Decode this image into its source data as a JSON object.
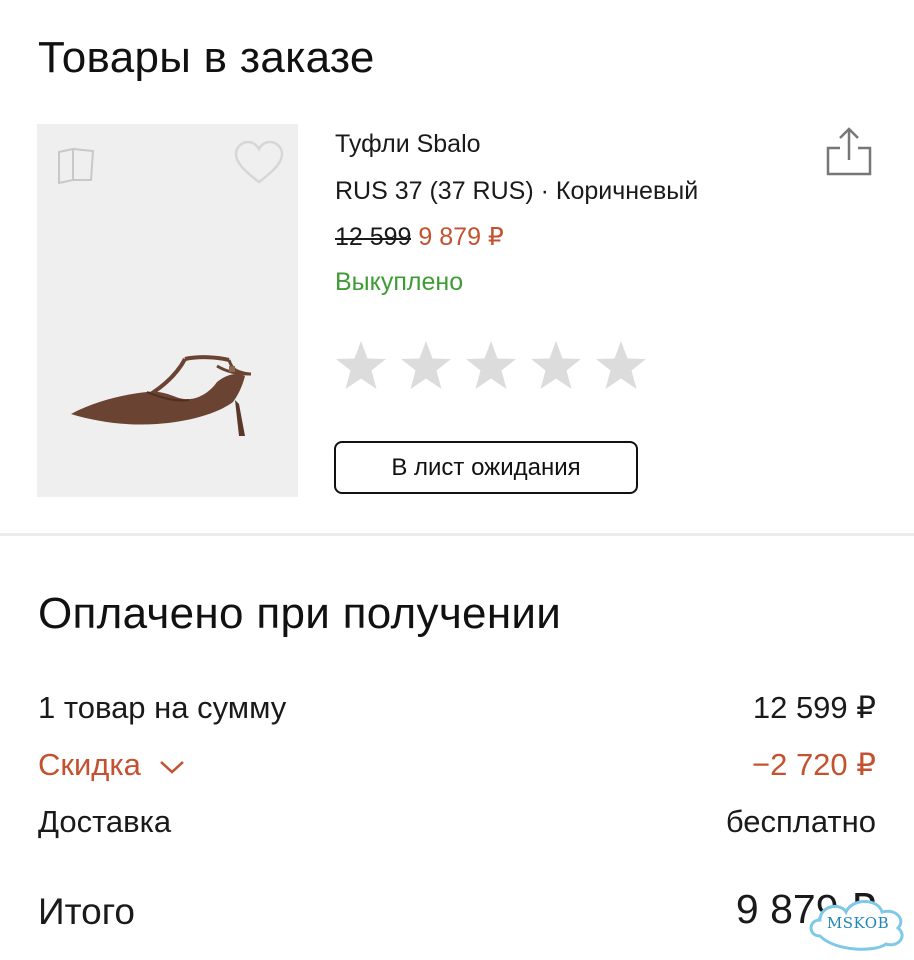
{
  "order_items": {
    "title": "Товары в заказе",
    "product": {
      "name": "Туфли Sbalo",
      "variant": "RUS 37 (37 RUS) · Коричневый",
      "old_price": "12 599",
      "new_price": "9 879 ₽",
      "status": "Выкуплено",
      "rating_stars": 5,
      "rating_value": 0,
      "waitlist_button": "В лист ожидания",
      "icons": [
        "compare-icon",
        "heart-icon",
        "share-icon"
      ]
    }
  },
  "payment": {
    "title": "Оплачено при получении",
    "rows": [
      {
        "label": "1 товар на сумму",
        "value": "12 599 ₽"
      },
      {
        "label": "Скидка",
        "value": "−2 720 ₽"
      },
      {
        "label": "Доставка",
        "value": "бесплатно"
      }
    ],
    "total_label": "Итого",
    "total_value": "9 879 ₽"
  },
  "watermark": "MSKOB",
  "colors": {
    "accent": "#c4512f",
    "success": "#3f9c35",
    "star_empty": "#dcdcdc",
    "image_bg": "#efefef",
    "shoe": "#6b4333"
  }
}
